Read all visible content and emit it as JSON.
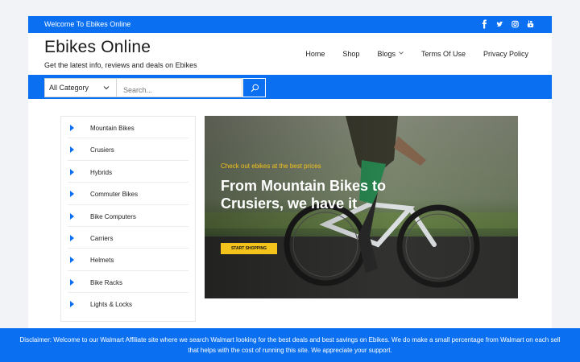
{
  "topbar": {
    "welcome": "Welcome To Ebikes Online",
    "social": [
      {
        "icon": "facebook-icon",
        "glyph": "f"
      },
      {
        "icon": "twitter-icon",
        "glyph": "t"
      },
      {
        "icon": "instagram-icon",
        "glyph": "ig"
      },
      {
        "icon": "youtube-icon",
        "glyph": "yt"
      }
    ]
  },
  "header": {
    "brand": "Ebikes Online",
    "tagline": "Get the latest info, reviews and deals on Ebikes",
    "nav": [
      "Home",
      "Shop",
      "Blogs",
      "Terms Of Use",
      "Privacy Policy"
    ]
  },
  "search": {
    "category_selected": "All Category",
    "placeholder": "Search..."
  },
  "categories": [
    "Mountain Bikes",
    "Crusiers",
    "Hybrids",
    "Commuter Bikes",
    "Bike Computers",
    "Carriers",
    "Helmets",
    "Bike Racks",
    "Lights & Locks"
  ],
  "hero": {
    "kicker": "Check out ebikes at the best prices",
    "headline": "From Mountain Bikes to Crusiers, we have it",
    "cta": "START SHOPPING"
  },
  "disclaimer": "Disclaimer: Welcome to our Walmart Affiliate site where we search Walmart looking for the best deals and best savings on Ebikes. We do make a small percentage from Walmart on each sell that helps with the cost of running this site. We appreciate your support.",
  "colors": {
    "primary": "#0a6ff0",
    "accent": "#f3c21b"
  }
}
